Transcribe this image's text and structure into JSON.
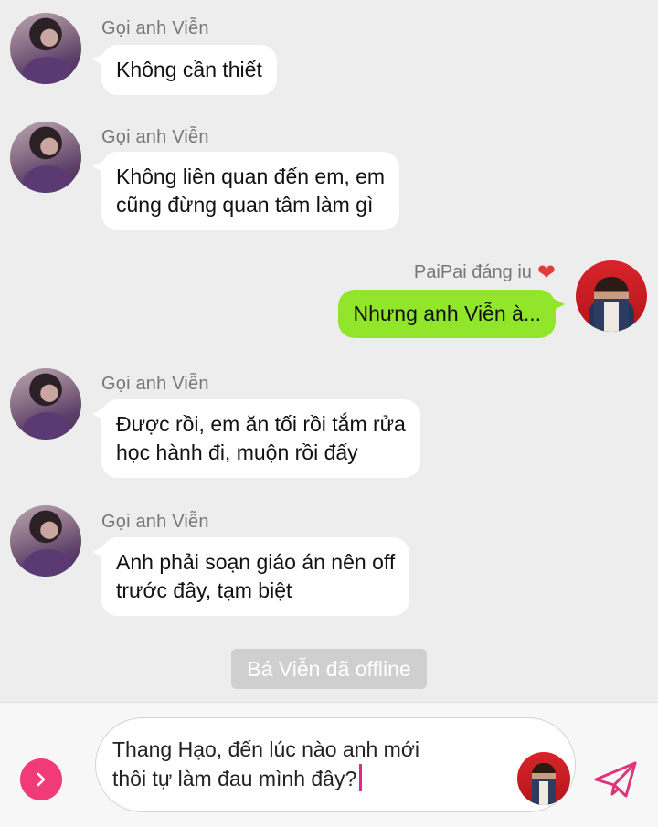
{
  "messages": [
    {
      "sender": "Gọi anh Viễn",
      "line1": "Không cần thiết",
      "line2": ""
    },
    {
      "sender": "Gọi anh Viễn",
      "line1": "Không liên quan đến em, em",
      "line2": "cũng đừng quan tâm làm gì"
    },
    {
      "sender": "PaiPai đáng iu",
      "text": "Nhưng anh Viễn à..."
    },
    {
      "sender": "Gọi anh Viễn",
      "line1": "Được rồi, em ăn tối rồi tắm rửa",
      "line2": "học hành đi, muộn rồi đấy"
    },
    {
      "sender": "Gọi anh Viễn",
      "line1": "Anh phải soạn giáo án nên off",
      "line2": "trước đây, tạm biệt"
    }
  ],
  "system_notice": "Bá Viễn đã offline",
  "composer": {
    "text": "Thang Hạo, đến lúc nào anh mới\nthôi tự làm đau mình đây?"
  },
  "icons": {
    "heart": "heart-icon",
    "expand": "chevron-right-icon",
    "send": "paper-plane-icon"
  },
  "colors": {
    "outgoing_bubble": "#91e62c",
    "incoming_bubble": "#ffffff",
    "accent": "#f13a78",
    "send_icon": "#e0347a"
  }
}
